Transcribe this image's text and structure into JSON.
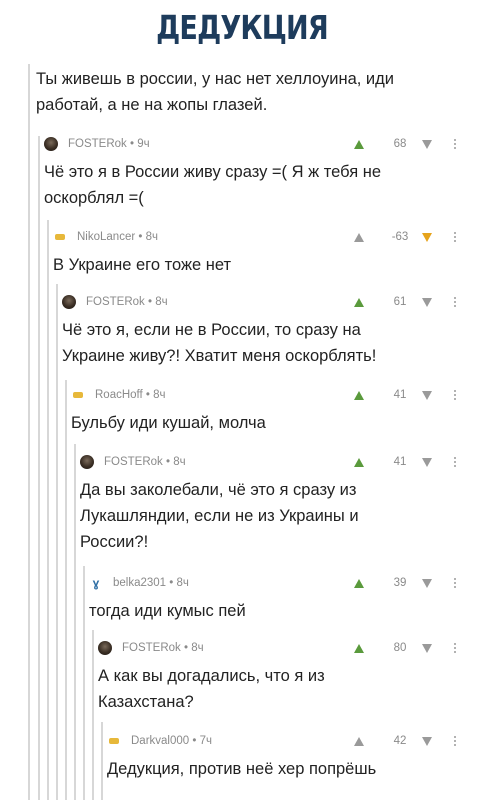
{
  "title": "ДЕДУКЦИЯ",
  "post": {
    "text_line1": "Ты живешь в россии, у нас нет хеллоуина, иди",
    "text_line2": "работай, а не на жопы глазей."
  },
  "comments": [
    {
      "author": "FOSTERok",
      "time": "9ч",
      "score": "68",
      "vote": "up",
      "lines": [
        "Чё это я в России живу сразу =( Я ж тебя не",
        "оскорблял =("
      ]
    },
    {
      "author": "NikoLancer",
      "time": "8ч",
      "score": "-63",
      "vote": "down",
      "lines": [
        "В Украине его тоже нет"
      ]
    },
    {
      "author": "FOSTERok",
      "time": "8ч",
      "score": "61",
      "vote": "up",
      "lines": [
        "Чё это я, если не в России, то сразу на",
        "Украине живу?! Хватит меня оскорблять!"
      ]
    },
    {
      "author": "RoacHoff",
      "time": "8ч",
      "score": "41",
      "vote": "up",
      "lines": [
        "Бульбу иди кушай, молча"
      ]
    },
    {
      "author": "FOSTERok",
      "time": "8ч",
      "score": "41",
      "vote": "up",
      "lines": [
        "Да вы заколебали, чё это я сразу из",
        "Лукашляндии, если не из Украины и",
        "России?!"
      ]
    },
    {
      "author": "belka2301",
      "time": "8ч",
      "score": "39",
      "vote": "up",
      "lines": [
        "тогда иди кумыс пей"
      ]
    },
    {
      "author": "FOSTERok",
      "time": "8ч",
      "score": "80",
      "vote": "up",
      "lines": [
        "А как вы догадались, что я из",
        "Казахстана?"
      ]
    },
    {
      "author": "Darkval000",
      "time": "7ч",
      "score": "42",
      "vote": "none",
      "lines": [
        "Дедукция, против неё хер попрёшь"
      ]
    }
  ],
  "separator": " • ",
  "colors": {
    "title": "#1e3c5c",
    "upvote": "#5a9a3c",
    "downvote_active": "#e6a31b",
    "thread_line": "#d7d7d7"
  },
  "icons": {
    "upvote": "triangle-up",
    "downvote": "triangle-down",
    "more": "vertical-dots"
  }
}
